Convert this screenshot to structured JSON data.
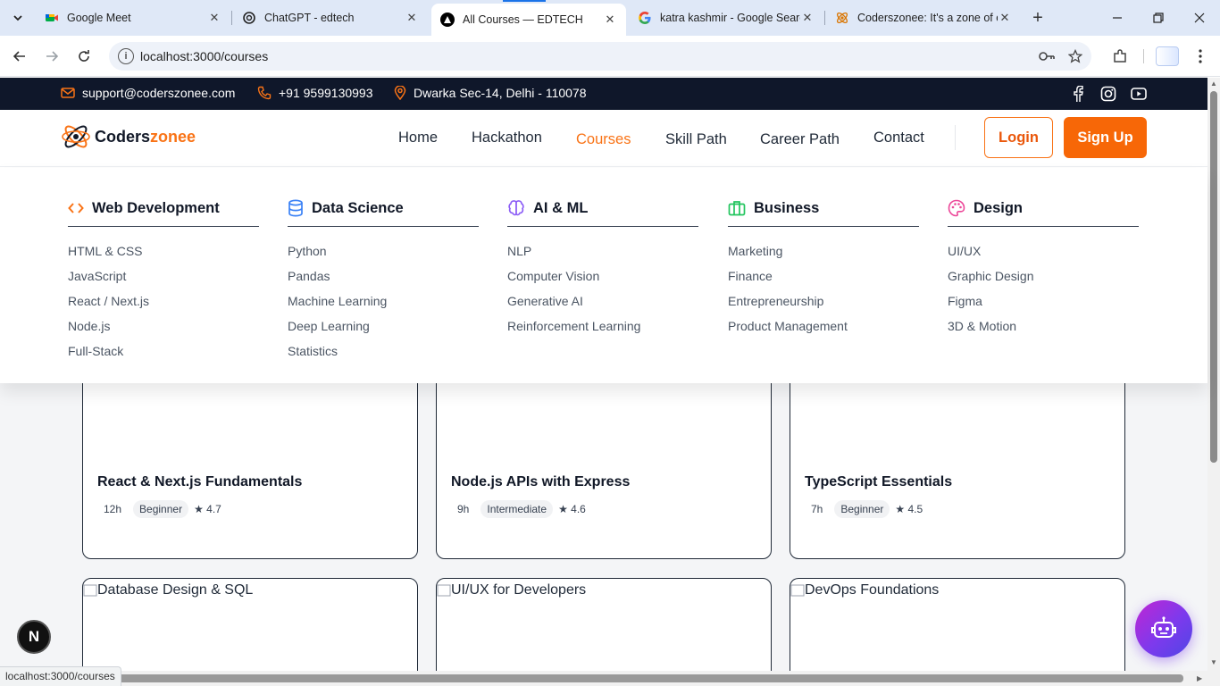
{
  "browser": {
    "tabs": [
      {
        "title": "Google Meet",
        "favicon": "google-meet-icon",
        "close": "✕"
      },
      {
        "title": "ChatGPT - edtech",
        "favicon": "chatgpt-icon",
        "close": "✕"
      },
      {
        "title": "All Courses — EDTECH",
        "favicon": "site-icon",
        "close": "✕"
      },
      {
        "title": "katra kashmir - Google Search",
        "favicon": "google-icon",
        "close": "✕"
      },
      {
        "title": "Coderszonee: It's a zone of coders",
        "favicon": "coderszonee-icon",
        "close": "✕"
      }
    ],
    "url": "localhost:3000/courses",
    "status_url": "localhost:3000/courses"
  },
  "topbar": {
    "email": "support@coderszonee.com",
    "phone": "+91 9599130993",
    "address": "Dwarka Sec-14, Delhi - 110078"
  },
  "header": {
    "logo_a": "Coders",
    "logo_b": "zonee",
    "nav": [
      "Home",
      "Hackathon",
      "Courses",
      "Skill Path",
      "Career Path",
      "Contact"
    ],
    "active_nav": "Courses",
    "login": "Login",
    "signup": "Sign Up"
  },
  "megamenu": [
    {
      "title": "Web Development",
      "icon": "code-icon",
      "color": "#f97316",
      "items": [
        "HTML & CSS",
        "JavaScript",
        "React / Next.js",
        "Node.js",
        "Full-Stack"
      ]
    },
    {
      "title": "Data Science",
      "icon": "database-icon",
      "color": "#3b82f6",
      "items": [
        "Python",
        "Pandas",
        "Machine Learning",
        "Deep Learning",
        "Statistics"
      ]
    },
    {
      "title": "AI & ML",
      "icon": "brain-icon",
      "color": "#8b5cf6",
      "items": [
        "NLP",
        "Computer Vision",
        "Generative AI",
        "Reinforcement Learning"
      ]
    },
    {
      "title": "Business",
      "icon": "briefcase-icon",
      "color": "#22c55e",
      "items": [
        "Marketing",
        "Finance",
        "Entrepreneurship",
        "Product Management"
      ]
    },
    {
      "title": "Design",
      "icon": "palette-icon",
      "color": "#ec4899",
      "items": [
        "UI/UX",
        "Graphic Design",
        "Figma",
        "3D & Motion"
      ]
    }
  ],
  "courses": [
    {
      "title": "React & Next.js Fundamentals",
      "hours": "12h",
      "level": "Beginner",
      "rating": "★ 4.7"
    },
    {
      "title": "Node.js APIs with Express",
      "hours": "9h",
      "level": "Intermediate",
      "rating": "★ 4.6"
    },
    {
      "title": "TypeScript Essentials",
      "hours": "7h",
      "level": "Beginner",
      "rating": "★ 4.5"
    },
    {
      "title": "Database Design & SQL"
    },
    {
      "title": "UI/UX for Developers"
    },
    {
      "title": "DevOps Foundations"
    }
  ],
  "badge_letter": "N"
}
